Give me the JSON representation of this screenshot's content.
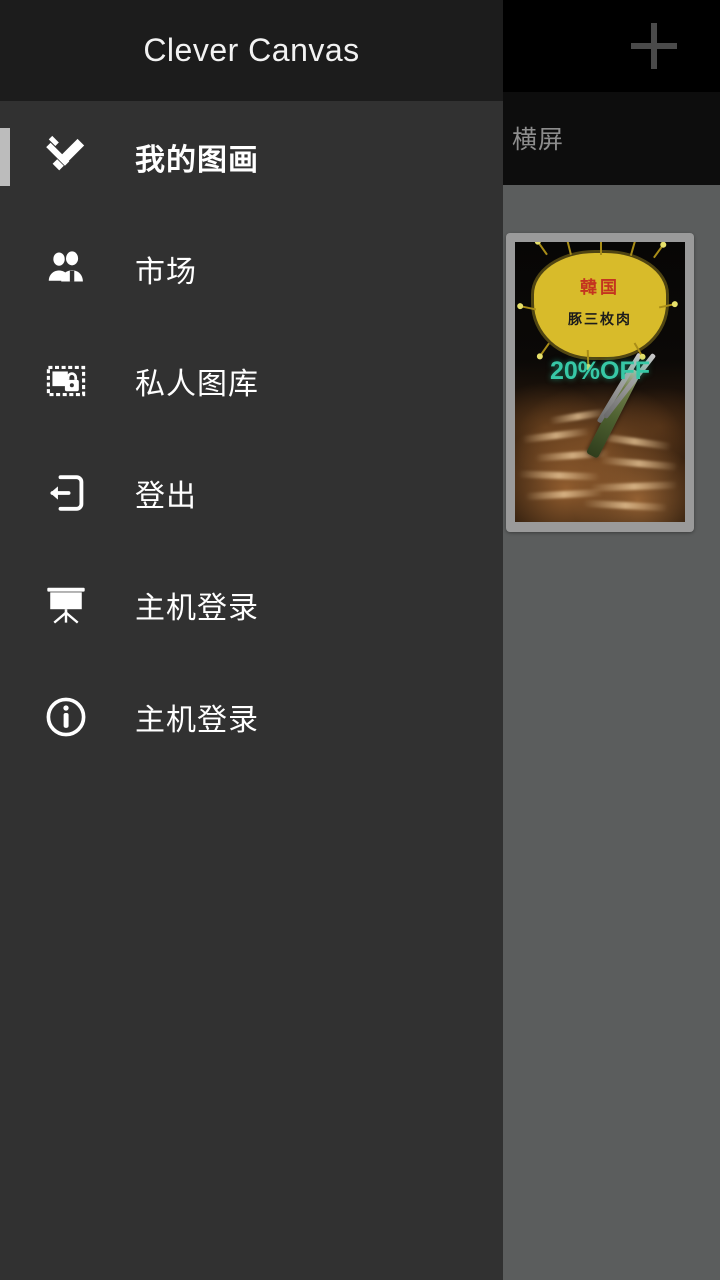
{
  "app": {
    "actionbar": {
      "add_button_label": "+",
      "add_icon": "plus-icon"
    },
    "tabs": [
      {
        "label": "横屏",
        "selected": true
      }
    ],
    "gallery": {
      "items": [
        {
          "icon": "image-thumbnail",
          "poster_headline": "韓国",
          "poster_subline": "豚三枚肉",
          "poster_offer": "20%OFF"
        }
      ]
    }
  },
  "drawer": {
    "title": "Clever Canvas",
    "scroll_indicator": "scrollbar-thumb",
    "items": [
      {
        "label": "我的图画",
        "icon": "pencil-brush-icon",
        "selected": true
      },
      {
        "label": "市场",
        "icon": "people-group-icon",
        "selected": false
      },
      {
        "label": "私人图库",
        "icon": "locked-picture-icon",
        "selected": false
      },
      {
        "label": "登出",
        "icon": "logout-icon",
        "selected": false
      },
      {
        "label": "主机登录",
        "icon": "projector-icon",
        "selected": false
      },
      {
        "label": "主机登录",
        "icon": "info-icon",
        "selected": false
      }
    ]
  },
  "colors": {
    "drawer_bg": "#313131",
    "drawer_header_bg": "#1c1c1c",
    "actionbar_bg": "#000000",
    "tabbar_bg": "#0d0d0d",
    "content_scrim": "#5b5d5d",
    "text_primary": "#ffffff",
    "text_muted": "#8d8d8d",
    "plus_icon": "#4a4a4a",
    "scroll_indicator": "#bcbcbc",
    "poster_yellow": "#d8bb2a",
    "poster_red": "#c4341f",
    "poster_teal": "#37c8a6"
  }
}
